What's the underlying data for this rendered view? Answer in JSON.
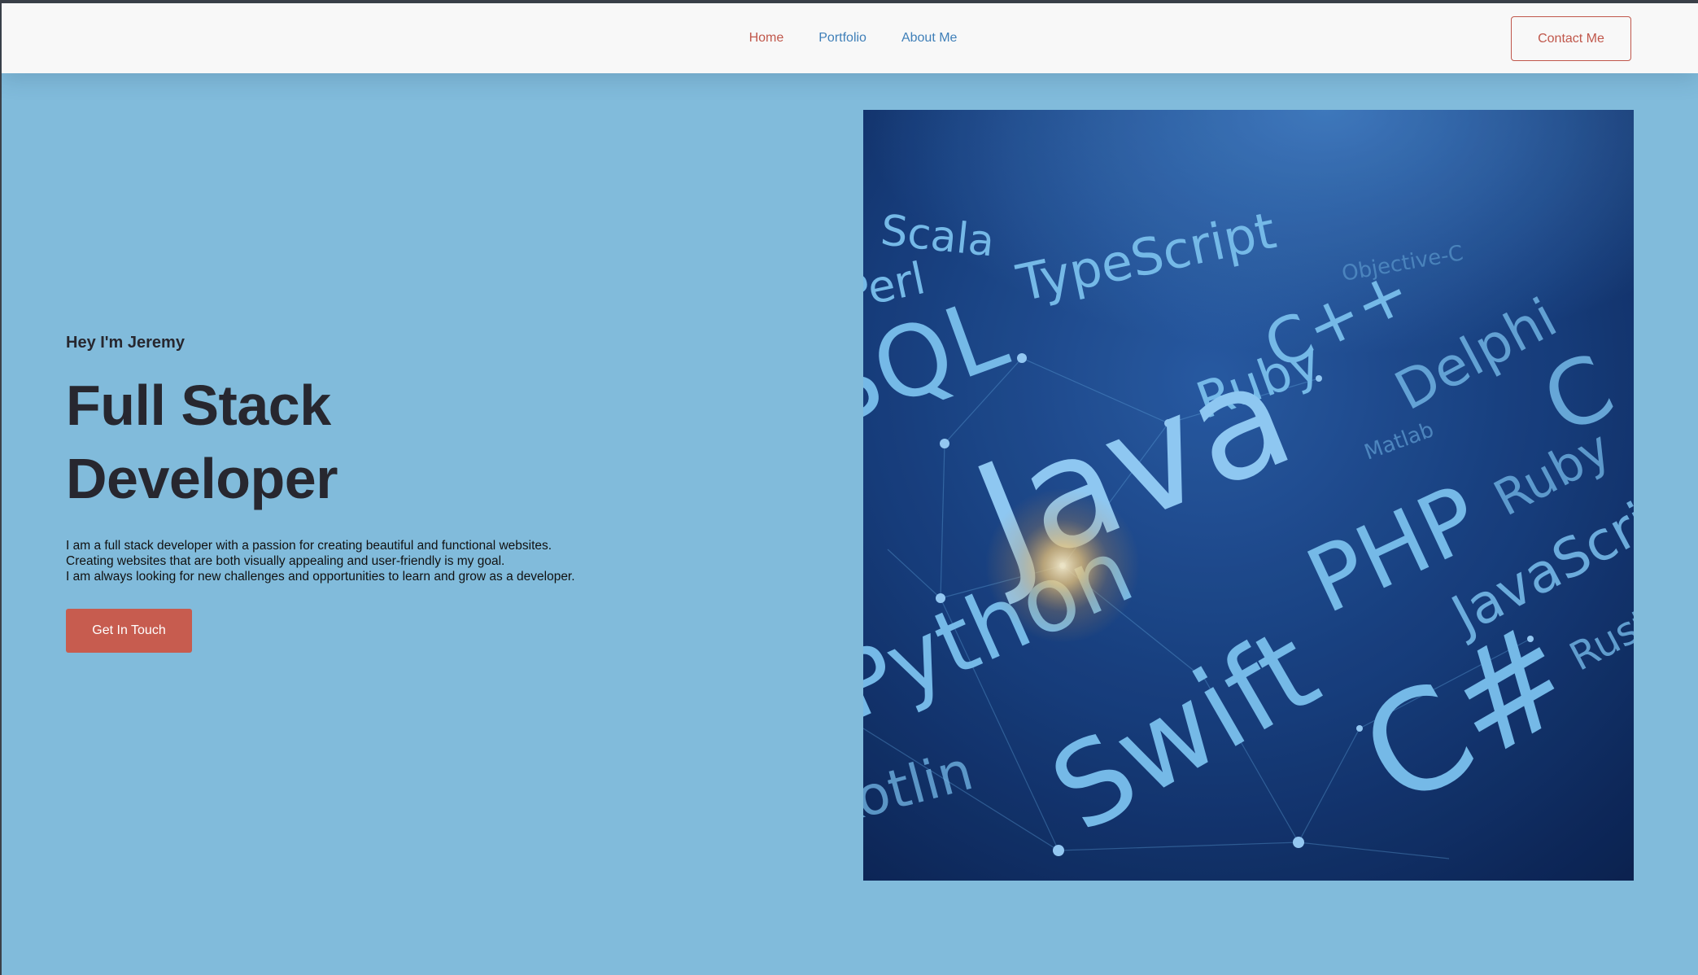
{
  "header": {
    "nav": [
      {
        "label": "Home",
        "active": true
      },
      {
        "label": "Portfolio",
        "active": false
      },
      {
        "label": "About Me",
        "active": false
      }
    ],
    "contact_label": "Contact Me"
  },
  "hero": {
    "greeting": "Hey I'm Jeremy",
    "headline_line1": "Full Stack",
    "headline_line2": "Developer",
    "intro": [
      "I am a full stack developer with a passion for creating beautiful and functional websites.",
      "Creating websites that are both visually appealing and user-friendly is my goal.",
      "I am always looking for new challenges and opportunities to learn and grow as a developer."
    ],
    "cta_label": "Get In Touch"
  },
  "image": {
    "languages": [
      "Scala",
      "Perl",
      "TypeScript",
      "Objective-C",
      "C++",
      "SQL",
      "Ruby",
      "Delphi",
      "Matlab",
      "C",
      "Java",
      "Ruby",
      "PHP",
      "JavaScript",
      "Python",
      "Rust",
      "Swift",
      "C#",
      "Kotlin"
    ]
  },
  "colors": {
    "background": "#81bbdb",
    "accent": "#c0574b",
    "link": "#3f7fb8",
    "heading": "#27272f"
  }
}
